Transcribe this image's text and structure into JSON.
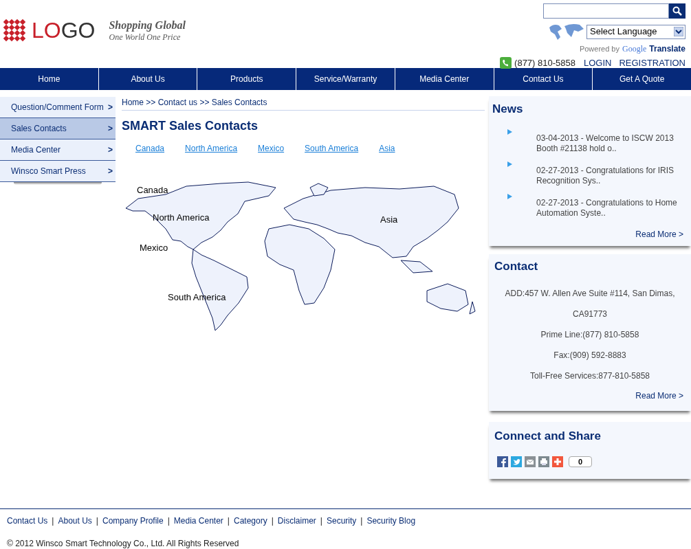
{
  "header": {
    "logo": "LOGO",
    "tagline": "Shopping Global",
    "subtagline": "One World One Price",
    "language_select": "Select Language",
    "powered_by": "Powered by",
    "google": "Google",
    "translate": "Translate",
    "phone": "(877) 810-5858",
    "links": [
      "LOGIN",
      "REGISTRATION"
    ]
  },
  "nav": [
    "Home",
    "About Us",
    "Products",
    "Service/Warranty",
    "Media Center",
    "Contact Us",
    "Get A Quote"
  ],
  "sidebar": {
    "arrow": ">",
    "items": [
      {
        "label": "Question/Comment Form",
        "selected": false
      },
      {
        "label": "Sales Contacts",
        "selected": true
      },
      {
        "label": "Media Center",
        "selected": false
      },
      {
        "label": "Winsco Smart Press",
        "selected": false
      }
    ]
  },
  "breadcrumb": [
    "Home",
    "Contact us",
    "Sales Contacts"
  ],
  "breadcrumb_separator": ">>",
  "title": "SMART Sales Contacts",
  "region_links": [
    "Canada",
    "North America",
    "Mexico",
    "South America",
    "Asia"
  ],
  "map_labels": [
    "Canada",
    "North America",
    "Mexico",
    "South America",
    "Asia"
  ],
  "news": {
    "title": "News",
    "items": [
      "03-04-2013 - Welcome to ISCW 2013 Booth #21138 hold o..",
      "02-27-2013 - Congratulations for IRIS Recognition Sys..",
      "02-27-2013 - Congratulations to Home Automation Syste.."
    ],
    "read_more": "Read More >"
  },
  "contact": {
    "title": "Contact",
    "lines": [
      "ADD:457 W. Allen Ave Suite #114, San Dimas,",
      "CA91773",
      "Prime Line:(877) 810-5858",
      "Fax:(909) 592-8883",
      "Toll-Free Services:877-810-5858"
    ],
    "read_more": "Read More >"
  },
  "share": {
    "title": "Connect and Share",
    "count": "0"
  },
  "footer": {
    "links": [
      "Contact Us",
      "About Us",
      "Company Profile",
      "Media Center",
      "Category",
      "Disclaimer",
      "Security",
      "Security Blog"
    ],
    "separator": "|",
    "copyright": "© 2012 Winsco Smart Technology Co., Ltd. All Rights Reserved"
  }
}
